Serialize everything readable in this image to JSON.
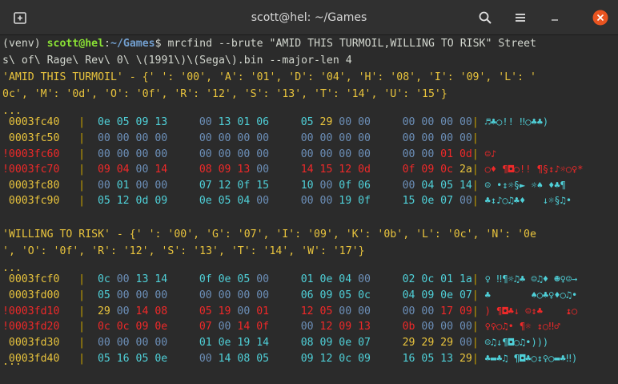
{
  "window": {
    "title": "scott@hel: ~/Games"
  },
  "prompt": {
    "venv": "(venv) ",
    "user_host": "scott@hel",
    "colon": ":",
    "path": "~/Games",
    "dollar": "$ ",
    "command": "mrcfind --brute \"AMID THIS TURMOIL,WILLING TO RISK\" Street",
    "command_cont": "s\\ of\\ Rage\\ Rev\\ 0\\ \\(1991\\)\\(Sega\\).bin --major-len 4"
  },
  "blocks": [
    {
      "map_lines": [
        "'AMID THIS TURMOIL' - {' ': '00', 'A': '01', 'D': '04', 'H': '08', 'I': '09', 'L': '",
        "0c', 'M': '0d', 'O': '0f', 'R': '12', 'S': '13', 'T': '14', 'U': '15'}"
      ],
      "ellipsis": "...",
      "rows": [
        {
          "marker": " ",
          "addr": "0003fc40",
          "bytes": [
            "0e",
            "05",
            "09",
            "13",
            "00",
            "13",
            "01",
            "06",
            "05",
            "29",
            "00",
            "00",
            "00",
            "00",
            "00",
            "00"
          ],
          "ascii": "♬♣○!! ‼○♣♣)"
        },
        {
          "marker": " ",
          "addr": "0003fc50",
          "bytes": [
            "00",
            "00",
            "00",
            "00",
            "00",
            "00",
            "00",
            "00",
            "00",
            "00",
            "00",
            "00",
            "00",
            "00",
            "00",
            "00"
          ],
          "ascii": ""
        },
        {
          "marker": "!",
          "addr": "0003fc60",
          "bytes": [
            "00",
            "00",
            "00",
            "00",
            "00",
            "00",
            "00",
            "00",
            "00",
            "00",
            "00",
            "00",
            "00",
            "00",
            "01",
            "0d"
          ],
          "ascii": "☺♪"
        },
        {
          "marker": "!",
          "addr": "0003fc70",
          "bytes": [
            "09",
            "04",
            "00",
            "14",
            "08",
            "09",
            "13",
            "00",
            "14",
            "15",
            "12",
            "0d",
            "0f",
            "09",
            "0c",
            "2a"
          ],
          "ascii": "○♦ ¶◘○!! ¶§↕♪☼○♀*"
        },
        {
          "marker": " ",
          "addr": "0003fc80",
          "bytes": [
            "00",
            "01",
            "00",
            "00",
            "07",
            "12",
            "0f",
            "15",
            "10",
            "00",
            "0f",
            "06",
            "00",
            "04",
            "05",
            "14"
          ],
          "ascii": "☺ •↕☼§► ☼♠ ♦♣¶"
        },
        {
          "marker": " ",
          "addr": "0003fc90",
          "bytes": [
            "05",
            "12",
            "0d",
            "09",
            "0e",
            "05",
            "04",
            "00",
            "00",
            "00",
            "19",
            "0f",
            "15",
            "0e",
            "07",
            "00"
          ],
          "ascii": "♣↕♪○♫♣♦   ↓☼§♫•"
        }
      ]
    },
    {
      "map_lines": [
        "'WILLING TO RISK' - {' ': '00', 'G': '07', 'I': '09', 'K': '0b', 'L': '0c', 'N': '0e",
        "', 'O': '0f', 'R': '12', 'S': '13', 'T': '14', 'W': '17'}"
      ],
      "ellipsis": "...",
      "rows": [
        {
          "marker": " ",
          "addr": "0003fcf0",
          "bytes": [
            "0c",
            "00",
            "13",
            "14",
            "0f",
            "0e",
            "05",
            "00",
            "01",
            "0e",
            "04",
            "00",
            "02",
            "0c",
            "01",
            "1a"
          ],
          "ascii": "♀ ‼¶☼♫♣ ☺♫♦ ☻♀☺→"
        },
        {
          "marker": " ",
          "addr": "0003fd00",
          "bytes": [
            "05",
            "00",
            "00",
            "00",
            "00",
            "00",
            "00",
            "00",
            "06",
            "09",
            "05",
            "0c",
            "04",
            "09",
            "0e",
            "07"
          ],
          "ascii": "♣       ♠○♣♀♦○♫•"
        },
        {
          "marker": "!",
          "addr": "0003fd10",
          "bytes": [
            "29",
            "00",
            "14",
            "08",
            "05",
            "19",
            "00",
            "01",
            "12",
            "05",
            "00",
            "00",
            "00",
            "00",
            "17",
            "09"
          ],
          "ascii": ") ¶◘♣↓ ☺↕♣    ↨○"
        },
        {
          "marker": "!",
          "addr": "0003fd20",
          "bytes": [
            "0c",
            "0c",
            "09",
            "0e",
            "07",
            "00",
            "14",
            "0f",
            "00",
            "12",
            "09",
            "13",
            "0b",
            "00",
            "00",
            "00"
          ],
          "ascii": "♀♀○♫• ¶☼ ↕○‼♂"
        },
        {
          "marker": " ",
          "addr": "0003fd30",
          "bytes": [
            "00",
            "00",
            "00",
            "00",
            "01",
            "0e",
            "19",
            "14",
            "08",
            "09",
            "0e",
            "07",
            "29",
            "29",
            "29",
            "00"
          ],
          "ascii": "☺♫↓¶◘○♫•)))"
        },
        {
          "marker": " ",
          "addr": "0003fd40",
          "bytes": [
            "05",
            "16",
            "05",
            "0e",
            "00",
            "14",
            "08",
            "05",
            "09",
            "12",
            "0c",
            "09",
            "16",
            "05",
            "13",
            "29"
          ],
          "ascii": "♣▬♣♫ ¶◘♣○↕♀○▬♣‼)"
        }
      ]
    }
  ],
  "final_ellipsis": "...",
  "colors": {
    "background": "#2b2b2b",
    "titlebar": "#303030",
    "prompt_user": "#8ae234",
    "prompt_path": "#729fcf",
    "yellow": "#e9c43d",
    "red": "#ef2929",
    "cyan": "#4fd0d8"
  },
  "icons": {
    "new_tab": "new-tab-icon",
    "search": "search-icon",
    "menu": "hamburger-menu-icon",
    "minimize": "minimize-icon",
    "close": "close-icon"
  }
}
